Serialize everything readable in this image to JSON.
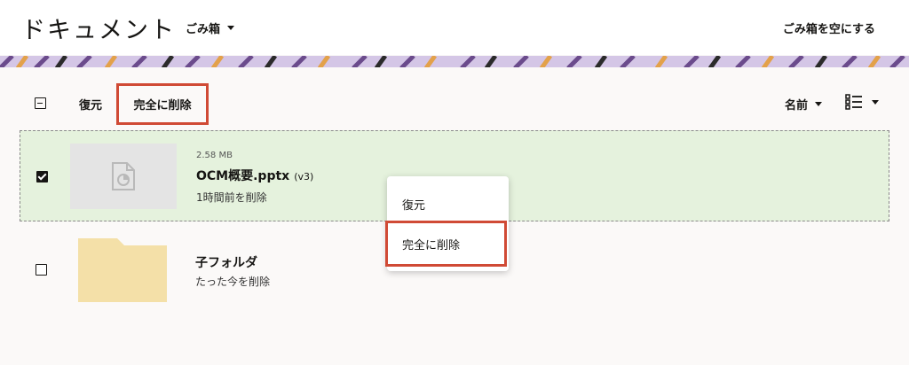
{
  "header": {
    "title": "ドキュメント",
    "folder_dropdown": "ごみ箱",
    "empty_trash_label": "ごみ箱を空にする"
  },
  "toolbar": {
    "restore_label": "復元",
    "delete_permanently_label": "完全に削除",
    "sort_label": "名前"
  },
  "items": [
    {
      "size": "2.58 MB",
      "name": "OCM概要.pptx",
      "version": "(v3)",
      "deleted": "1時間前を削除",
      "selected": true,
      "icon": "file-presentation-icon"
    },
    {
      "name": "子フォルダ",
      "deleted": "たった今を削除",
      "selected": false,
      "icon": "folder-icon"
    }
  ],
  "context_menu": {
    "restore_label": "復元",
    "delete_permanently_label": "完全に削除"
  },
  "colors": {
    "highlight_border": "#d04a35",
    "selected_row_bg": "#e5f2dd",
    "folder_color": "#f4e0a8",
    "banner_purple": "#6b4b8c",
    "banner_lavender": "#d4c6e6",
    "banner_orange": "#e3a14a"
  }
}
